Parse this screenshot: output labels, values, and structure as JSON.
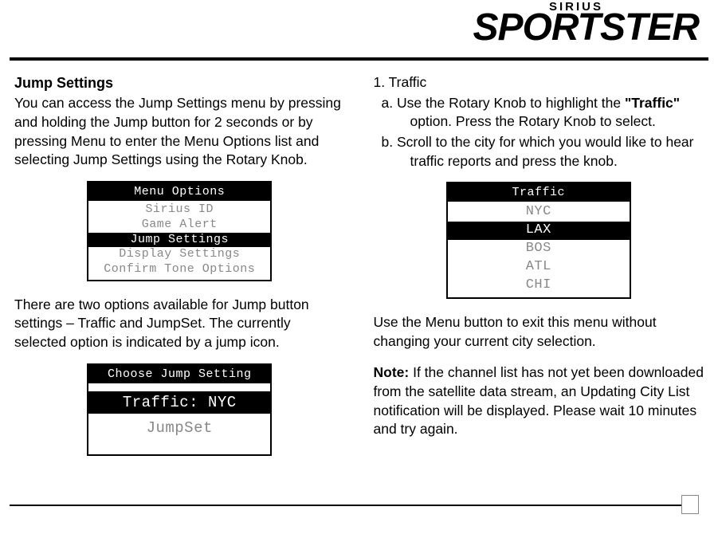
{
  "logo": {
    "top": "SIRIUS",
    "main": "SPORTSTER"
  },
  "left": {
    "title": "Jump Settings",
    "intro": "You can access the Jump Settings menu by pressing and holding the Jump button for 2 seconds or by pressing Menu to enter the Menu Options list and selecting Jump Settings using the Rotary Knob.",
    "screen1": {
      "header": "Menu Options",
      "rows": [
        {
          "label": "Sirius ID",
          "selected": false
        },
        {
          "label": "Game Alert",
          "selected": false
        },
        {
          "label": "Jump Settings",
          "selected": true
        },
        {
          "label": "Display Settings",
          "selected": false
        },
        {
          "label": "Confirm Tone Options",
          "selected": false
        }
      ]
    },
    "mid": "There are two options available for Jump button settings – Traffic and JumpSet.  The currently selected option is indicated by a jump icon.",
    "screen2": {
      "header": "Choose Jump Setting",
      "rows": [
        {
          "label": "Traffic: NYC",
          "selected": true
        },
        {
          "label": "JumpSet",
          "selected": false
        }
      ]
    }
  },
  "right": {
    "step1": "1. Traffic",
    "a1": "a. Use the Rotary Knob to highlight the ",
    "a1_bold": "\"Traffic\"",
    "a2_indent": "option.  Press the Rotary Knob to select.",
    "b1": "b. Scroll to the city for which you would like to hear",
    "b2_indent": "traffic reports and press the knob.",
    "screen3": {
      "header": "Traffic",
      "rows": [
        {
          "label": "NYC",
          "selected": false
        },
        {
          "label": "LAX",
          "selected": true
        },
        {
          "label": "BOS",
          "selected": false
        },
        {
          "label": "ATL",
          "selected": false
        },
        {
          "label": "CHI",
          "selected": false
        }
      ]
    },
    "exit": "Use the Menu button to exit this menu without changing your current city selection.",
    "note_label": "Note:",
    "note_body": " If the channel list has not yet been downloaded from the satellite data stream, an Updating City List notification will be displayed.  Please wait 10 minutes and try again."
  }
}
